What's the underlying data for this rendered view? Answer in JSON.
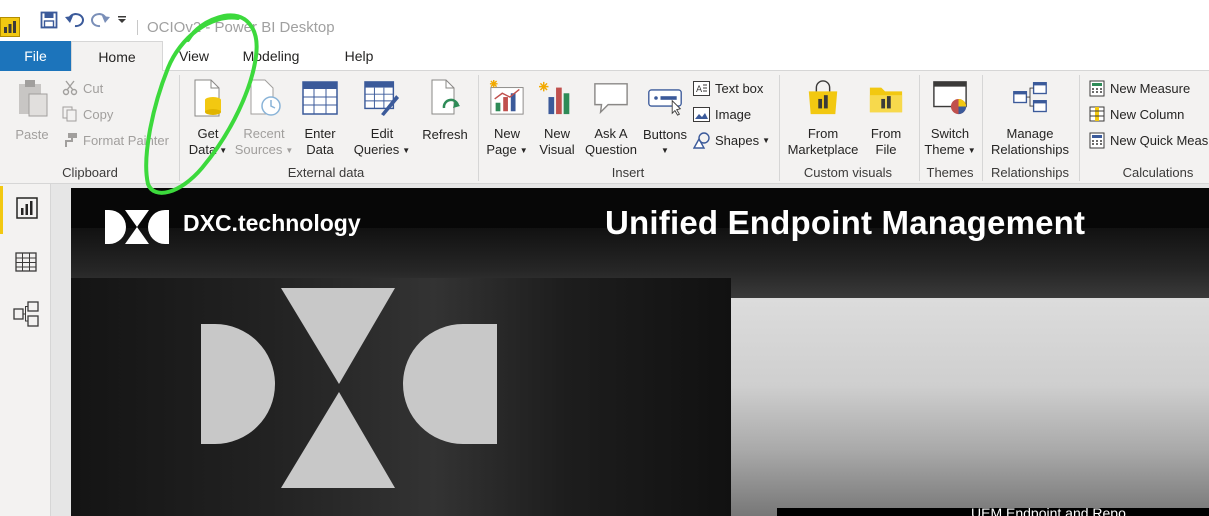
{
  "window": {
    "title": "OCIOv2 - Power BI Desktop"
  },
  "quick_access": {
    "icons": [
      "powerbi-logo-icon",
      "save-icon",
      "undo-icon",
      "redo-icon",
      "customize-icon"
    ]
  },
  "tabs": [
    {
      "label": "File"
    },
    {
      "label": "Home"
    },
    {
      "label": "View"
    },
    {
      "label": "Modeling"
    },
    {
      "label": "Help"
    }
  ],
  "ribbon": {
    "clipboard": {
      "group_label": "Clipboard",
      "paste": "Paste",
      "cut": "Cut",
      "copy": "Copy",
      "format_painter": "Format Painter"
    },
    "external_data": {
      "group_label": "External data",
      "get_data": [
        "Get",
        "Data"
      ],
      "recent_sources": [
        "Recent",
        "Sources"
      ],
      "enter_data": [
        "Enter",
        "Data"
      ],
      "edit_queries": [
        "Edit",
        "Queries"
      ],
      "refresh": "Refresh"
    },
    "insert": {
      "group_label": "Insert",
      "new_page": [
        "New",
        "Page"
      ],
      "new_visual": [
        "New",
        "Visual"
      ],
      "ask_question": [
        "Ask A",
        "Question"
      ],
      "buttons": "Buttons",
      "text_box": "Text box",
      "image": "Image",
      "shapes": "Shapes"
    },
    "custom_visuals": {
      "group_label": "Custom visuals",
      "from_marketplace": [
        "From",
        "Marketplace"
      ],
      "from_file": [
        "From",
        "File"
      ]
    },
    "themes": {
      "group_label": "Themes",
      "switch_theme": [
        "Switch",
        "Theme"
      ]
    },
    "relationships": {
      "group_label": "Relationships",
      "manage_relationships": [
        "Manage",
        "Relationships"
      ]
    },
    "calculations": {
      "group_label": "Calculations",
      "new_measure": "New Measure",
      "new_column": "New Column",
      "new_quick_measure": "New Quick Meas"
    }
  },
  "left_rail": {
    "items": [
      {
        "icon": "report-view-icon",
        "active": true
      },
      {
        "icon": "data-view-icon",
        "active": false
      },
      {
        "icon": "model-view-icon",
        "active": false
      }
    ]
  },
  "report": {
    "brand": "DXC.technology",
    "title": "Unified Endpoint Management",
    "footer": "UEM Endpoint and Repo..."
  },
  "colors": {
    "file_tab": "#1c74bb",
    "ribbon_bg": "#f3f2f1",
    "accent_yellow": "#f2c811",
    "annotation_green": "#3cd93c",
    "report_bg": "#070707"
  }
}
